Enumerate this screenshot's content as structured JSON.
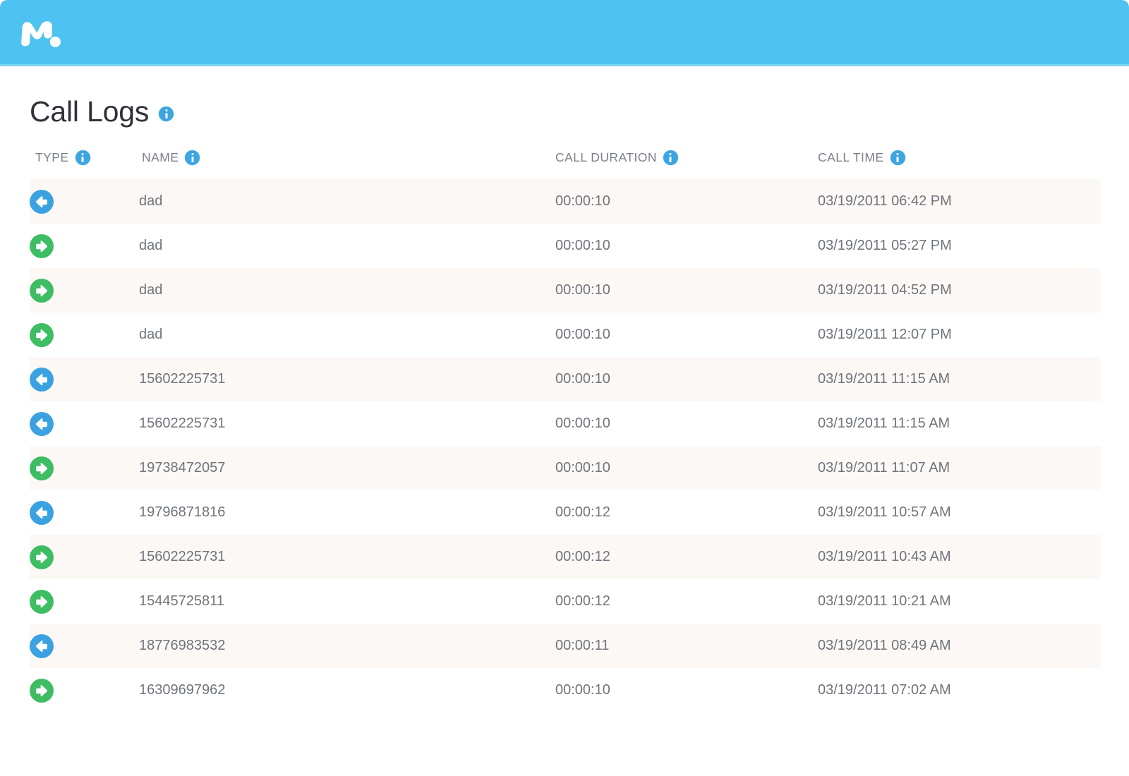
{
  "brand": {
    "logo_name": "mspy-logo",
    "header_color": "#4ec2f1"
  },
  "page": {
    "title": "Call Logs",
    "title_info_icon": "info-icon"
  },
  "table": {
    "columns": [
      {
        "key": "type",
        "label": "TYPE",
        "info_icon": "info-icon"
      },
      {
        "key": "name",
        "label": "NAME",
        "info_icon": "info-icon"
      },
      {
        "key": "duration",
        "label": "CALL DURATION",
        "info_icon": "info-icon"
      },
      {
        "key": "time",
        "label": "CALL TIME",
        "info_icon": "info-icon"
      }
    ],
    "legend": {
      "incoming_icon": "arrow-left-icon",
      "outgoing_icon": "arrow-right-icon",
      "incoming_color": "#3ba2e2",
      "outgoing_color": "#3ebd63"
    },
    "rows": [
      {
        "type": "incoming",
        "name": "dad",
        "duration": "00:00:10",
        "time": "03/19/2011 06:42 PM"
      },
      {
        "type": "outgoing",
        "name": "dad",
        "duration": "00:00:10",
        "time": "03/19/2011 05:27 PM"
      },
      {
        "type": "outgoing",
        "name": "dad",
        "duration": "00:00:10",
        "time": "03/19/2011 04:52 PM"
      },
      {
        "type": "outgoing",
        "name": "dad",
        "duration": "00:00:10",
        "time": "03/19/2011 12:07 PM"
      },
      {
        "type": "incoming",
        "name": "15602225731",
        "duration": "00:00:10",
        "time": "03/19/2011 11:15 AM"
      },
      {
        "type": "incoming",
        "name": "15602225731",
        "duration": "00:00:10",
        "time": "03/19/2011 11:15 AM"
      },
      {
        "type": "outgoing",
        "name": "19738472057",
        "duration": "00:00:10",
        "time": "03/19/2011 11:07 AM"
      },
      {
        "type": "incoming",
        "name": "19796871816",
        "duration": "00:00:12",
        "time": "03/19/2011 10:57 AM"
      },
      {
        "type": "outgoing",
        "name": "15602225731",
        "duration": "00:00:12",
        "time": "03/19/2011 10:43 AM"
      },
      {
        "type": "outgoing",
        "name": "15445725811",
        "duration": "00:00:12",
        "time": "03/19/2011 10:21 AM"
      },
      {
        "type": "incoming",
        "name": "18776983532",
        "duration": "00:00:11",
        "time": "03/19/2011 08:49 AM"
      },
      {
        "type": "outgoing",
        "name": "16309697962",
        "duration": "00:00:10",
        "time": "03/19/2011 07:02 AM"
      }
    ]
  }
}
